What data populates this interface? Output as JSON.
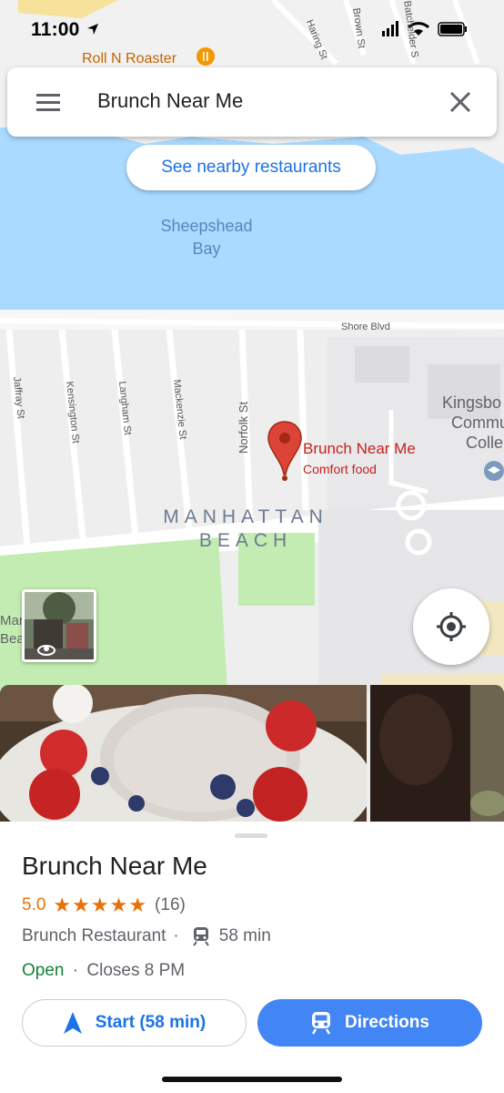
{
  "status_bar": {
    "time": "11:00"
  },
  "search": {
    "query": "Brunch Near Me"
  },
  "nearby_button": {
    "label": "See nearby restaurants"
  },
  "map": {
    "poi_roll_n_roaster": "Roll N Roaster",
    "water_label_line1": "Sheepshead",
    "water_label_line2": "Bay",
    "streets": {
      "haring": "Haring St",
      "brown": "Brown St",
      "batchelder": "Batchelder S",
      "shore_blvd": "Shore Blvd",
      "jaffray": "Jaffray St",
      "kensington": "Kensington St",
      "langham": "Langham St",
      "mackenzie": "Mackenzie St",
      "norfolk": "Norfolk St"
    },
    "campus_line1": "Kingsbo",
    "campus_line2": "Commu",
    "campus_line3": "Colle",
    "neighborhood_line1": "MANHATTAN",
    "neighborhood_line2": "BEACH",
    "left_edge_line1": "Man",
    "left_edge_line2": "Bea",
    "pin": {
      "title": "Brunch Near Me",
      "subtitle": "Comfort food"
    }
  },
  "place": {
    "name": "Brunch Near Me",
    "rating": "5.0",
    "stars": "★★★★★",
    "reviews": "(16)",
    "category": "Brunch Restaurant",
    "transit_time": "58 min",
    "open_status": "Open",
    "hours": "Closes 8 PM"
  },
  "actions": {
    "start_label": "Start (58 min)",
    "directions_label": "Directions"
  },
  "colors": {
    "accent_blue": "#1a73e8",
    "directions_blue": "#4285f4",
    "rating_orange": "#e8710a",
    "open_green": "#188038",
    "pin_red": "#db4437",
    "water": "#aadaff",
    "park": "#c3ecb2"
  }
}
